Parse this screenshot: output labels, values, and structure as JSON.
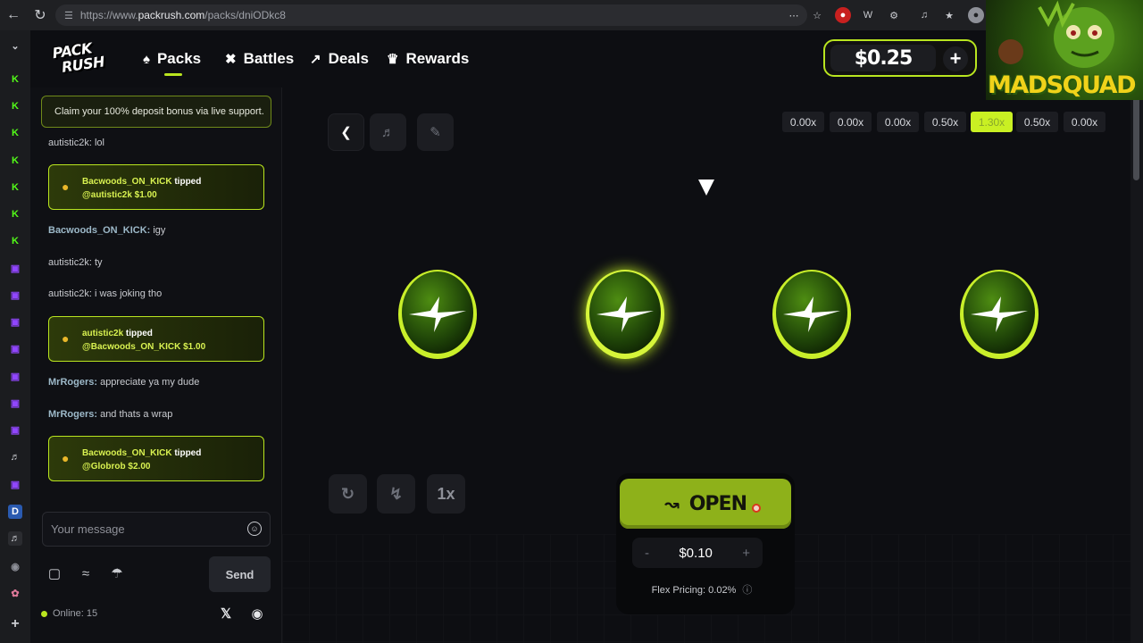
{
  "browser": {
    "url_prefix": "https://www.",
    "url_host": "packrush.com",
    "url_path": "/packs/dniODkc8"
  },
  "logo": {
    "line1": "PACK",
    "line2": "RUSH"
  },
  "nav": {
    "items": [
      {
        "label": "Packs",
        "icon": "cards-icon"
      },
      {
        "label": "Battles",
        "icon": "swords-icon"
      },
      {
        "label": "Deals",
        "icon": "trending-icon"
      },
      {
        "label": "Rewards",
        "icon": "trophy-icon"
      }
    ],
    "active": "Packs"
  },
  "wallet": {
    "balance": "$0.25",
    "add_label": "+"
  },
  "chat": {
    "promo": "Claim your 100% deposit bonus via live support.",
    "messages": [
      {
        "user": "autistic2k:",
        "text": " lol"
      },
      {
        "tip": true,
        "from": "Bacwoods_ON_KICK",
        "verb": " tipped",
        "to": "@autistic2k",
        "amount": " $1.00"
      },
      {
        "user": "Bacwoods_ON_KICK:",
        "text": " igy"
      },
      {
        "user": "autistic2k:",
        "text": " ty"
      },
      {
        "user": "autistic2k:",
        "text": " i was joking tho"
      },
      {
        "tip": true,
        "from": "autistic2k",
        "verb": " tipped",
        "to": "@Bacwoods_ON_KICK",
        "amount": " $1.00"
      },
      {
        "user": "MrRogers:",
        "text": " appreciate ya my dude"
      },
      {
        "user": "MrRogers:",
        "text": " and thats a wrap"
      },
      {
        "tip": true,
        "from": "Bacwoods_ON_KICK",
        "verb": " tipped",
        "to": "@Globrob",
        "amount": " $2.00"
      }
    ],
    "input_placeholder": "Your message",
    "send_label": "Send",
    "online": "Online: 15"
  },
  "stage": {
    "multipliers": [
      "0.00x",
      "0.00x",
      "0.00x",
      "0.50x",
      "1.30x",
      "0.50x",
      "0.00x"
    ],
    "selected_multiplier": "1.30x",
    "speed_label": "1x",
    "open_label": "OPEN",
    "price": "$0.10",
    "minus": "-",
    "plus": "+",
    "flex_pricing": "Flex Pricing: 0.02%",
    "coins_count": 4
  },
  "overlay": {
    "text": "MADSQUAD"
  },
  "colors": {
    "accent": "#b9e51f",
    "open_button": "#8eb11a",
    "background": "#0d0e12"
  }
}
